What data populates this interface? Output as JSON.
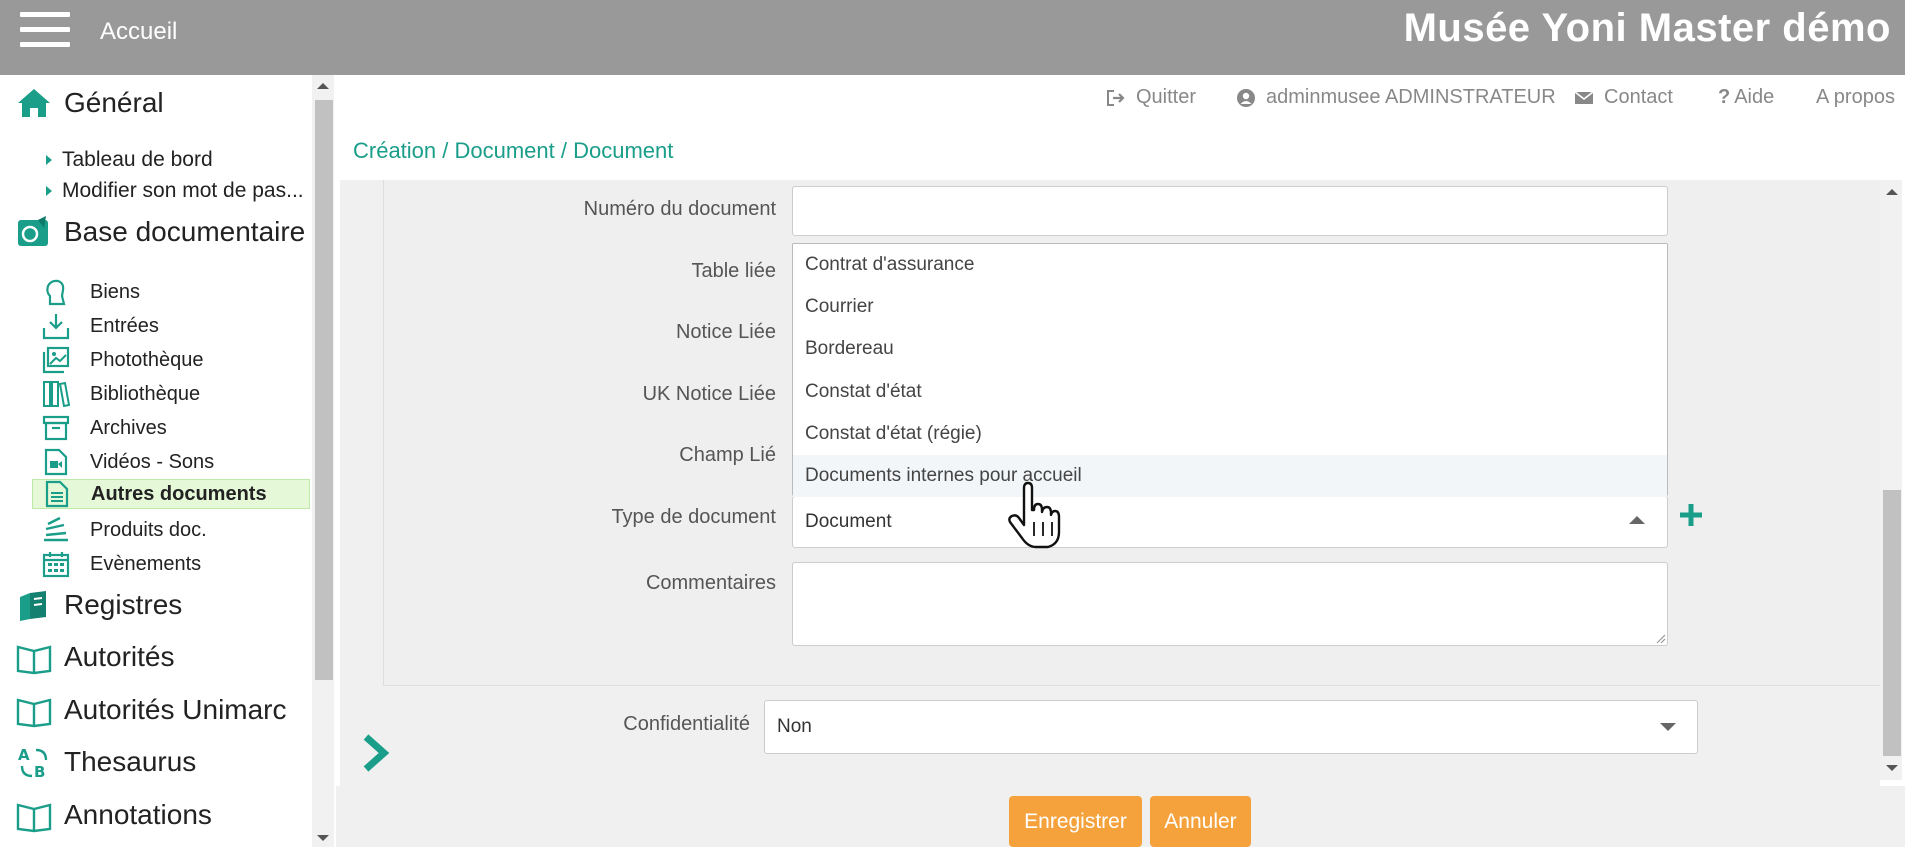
{
  "topbar": {
    "home_label": "Accueil",
    "app_title": "Musée Yoni Master démo"
  },
  "sidebar": {
    "general": {
      "label": "Général",
      "items": [
        "Tableau de bord",
        "Modifier son mot de pas..."
      ]
    },
    "base_doc": {
      "label": "Base documentaire",
      "items": [
        {
          "label": "Biens",
          "icon": "bust-icon"
        },
        {
          "label": "Entrées",
          "icon": "inbox-icon"
        },
        {
          "label": "Photothèque",
          "icon": "images-icon"
        },
        {
          "label": "Bibliothèque",
          "icon": "books-icon"
        },
        {
          "label": "Archives",
          "icon": "archive-box-icon"
        },
        {
          "label": "Vidéos - Sons",
          "icon": "video-file-icon"
        },
        {
          "label": "Autres documents",
          "icon": "document-icon",
          "active": true
        },
        {
          "label": "Produits doc.",
          "icon": "stack-icon"
        },
        {
          "label": "Evènements",
          "icon": "calendar-icon"
        }
      ]
    },
    "sections": [
      "Registres",
      "Autorités",
      "Autorités Unimarc",
      "Thesaurus",
      "Annotations"
    ]
  },
  "utilbar": {
    "quit": "Quitter",
    "user": "adminmusee ADMINSTRATEUR",
    "contact": "Contact",
    "help": "Aide",
    "about": "A propos"
  },
  "breadcrumb": "Création / Document / Document",
  "form": {
    "numero_label": "Numéro du document",
    "numero_value": "",
    "table_liee_label": "Table liée",
    "notice_liee_label": "Notice Liée",
    "uk_notice_label": "UK Notice Liée",
    "champ_lie_label": "Champ Lié",
    "type_label": "Type de document",
    "type_value": "Document",
    "commentaires_label": "Commentaires",
    "commentaires_value": "",
    "confidentialite_label": "Confidentialité",
    "confidentialite_value": "Non"
  },
  "dropdown": {
    "options": [
      "Contrat d'assurance",
      "Courrier",
      "Bordereau",
      "Constat d'état",
      "Constat d'état (régie)",
      "Documents internes pour accueil"
    ],
    "hovered_index": 5
  },
  "buttons": {
    "save": "Enregistrer",
    "cancel": "Annuler"
  },
  "colors": {
    "accent": "#1a9e8a",
    "button": "#f5a23c",
    "topbar": "#999999"
  }
}
